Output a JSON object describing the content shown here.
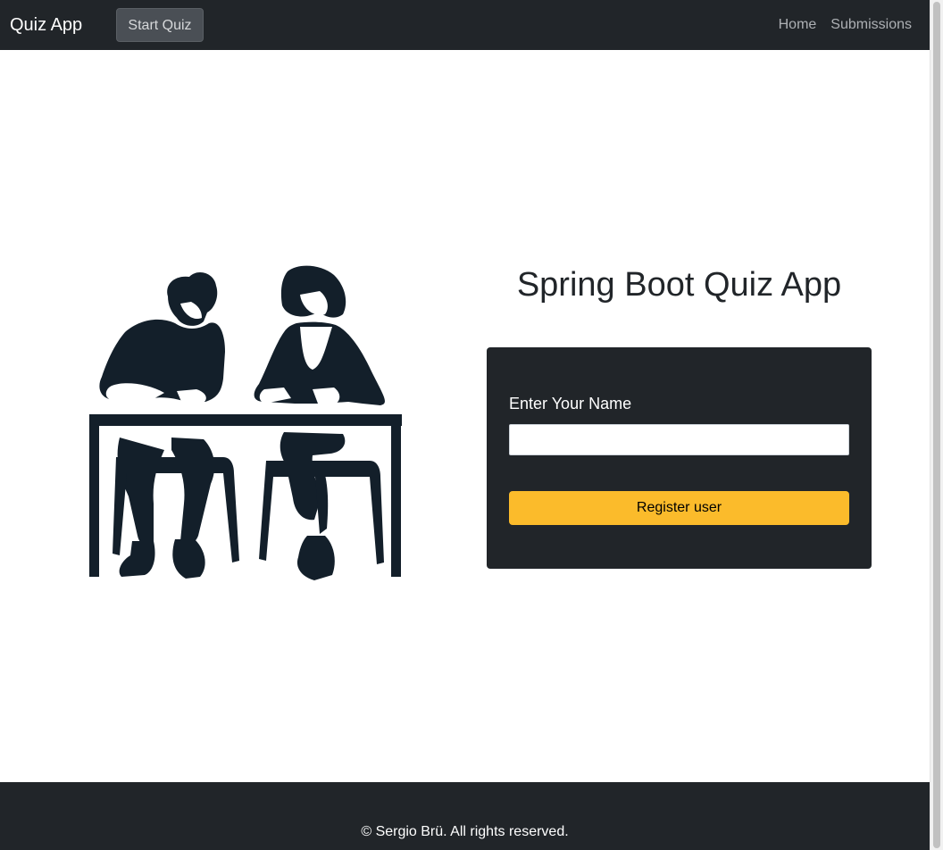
{
  "navbar": {
    "brand": "Quiz App",
    "start_quiz_label": "Start Quiz",
    "links": [
      "Home",
      "Submissions"
    ]
  },
  "main": {
    "title": "Spring Boot Quiz App",
    "form": {
      "name_label": "Enter Your Name",
      "name_value": "",
      "register_label": "Register user"
    }
  },
  "footer": {
    "text": "© Sergio Brü. All rights reserved."
  },
  "colors": {
    "dark": "#212529",
    "accent": "#fbbb2b",
    "illustration": "#131f2a"
  },
  "icons": {
    "illustration": "two-people-writing-at-desk-illustration"
  }
}
